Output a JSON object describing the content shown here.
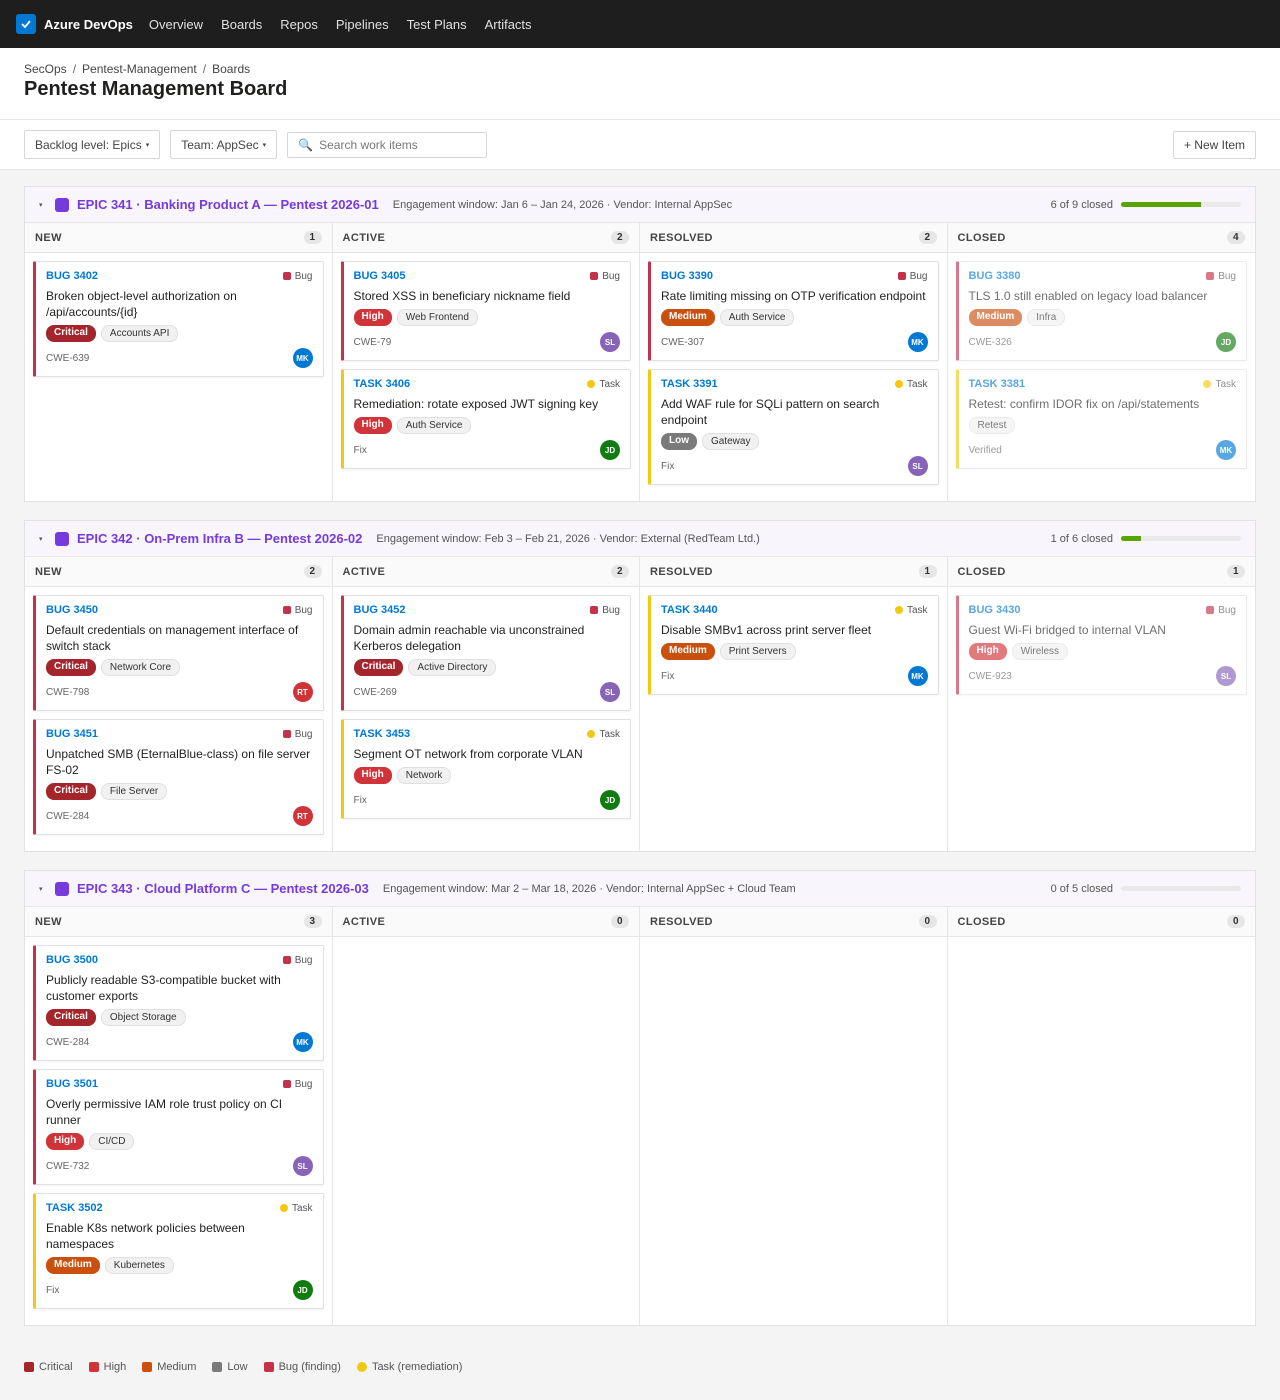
{
  "app": {
    "title": "Azure DevOps"
  },
  "nav": [
    "Overview",
    "Boards",
    "Repos",
    "Pipelines",
    "Test Plans",
    "Artifacts"
  ],
  "breadcrumb": [
    "SecOps",
    "Pentest-Management",
    "Boards"
  ],
  "page_title": "Pentest Management Board",
  "toolbar": {
    "backlog": "Backlog level: Epics",
    "team": "Team: AppSec",
    "search_placeholder": "Search work items",
    "new_item": "+ New Item"
  },
  "severity_colors": {
    "Critical": "#a4262c",
    "High": "#d13438",
    "Medium": "#ca5010",
    "Low": "#7a7a7a"
  },
  "epics": [
    {
      "title": "EPIC 341 · Banking Product A — Pentest 2026-01",
      "meta": "Engagement window: Jan 6 – Jan 24, 2026 · Vendor: Internal AppSec",
      "progress_text": "6 of 9 closed",
      "progress": 0.667,
      "columns": [
        {
          "name": "NEW",
          "count": "1",
          "cards": [
            {
              "id": "BUG 3402",
              "type": "Bug",
              "title": "Broken object-level authorization on /api/accounts/{id}",
              "severity": "Critical",
              "area": "Accounts API",
              "ref": "CWE-639",
              "assignee": "MK",
              "avatar_color": "#0078d4"
            }
          ]
        },
        {
          "name": "ACTIVE",
          "count": "2",
          "cards": [
            {
              "id": "BUG 3405",
              "type": "Bug",
              "title": "Stored XSS in beneficiary nickname field",
              "severity": "High",
              "area": "Web Frontend",
              "ref": "CWE-79",
              "assignee": "SL",
              "avatar_color": "#8764b8"
            },
            {
              "id": "TASK 3406",
              "type": "Task",
              "title": "Remediation: rotate exposed JWT signing key",
              "severity": "High",
              "area": "Auth Service",
              "ref": "Fix",
              "assignee": "JD",
              "avatar_color": "#107c10"
            }
          ]
        },
        {
          "name": "RESOLVED",
          "count": "2",
          "cards": [
            {
              "id": "BUG 3390",
              "type": "Bug",
              "title": "Rate limiting missing on OTP verification endpoint",
              "severity": "Medium",
              "area": "Auth Service",
              "ref": "CWE-307",
              "assignee": "MK",
              "avatar_color": "#0078d4"
            },
            {
              "id": "TASK 3391",
              "type": "Task",
              "title": "Add WAF rule for SQLi pattern on search endpoint",
              "severity": "Low",
              "area": "Gateway",
              "ref": "Fix",
              "assignee": "SL",
              "avatar_color": "#8764b8"
            }
          ]
        },
        {
          "name": "CLOSED",
          "count": "4",
          "closed": true,
          "cards": [
            {
              "id": "BUG 3380",
              "type": "Bug",
              "title": "TLS 1.0 still enabled on legacy load balancer",
              "severity": "Medium",
              "area": "Infra",
              "ref": "CWE-326",
              "assignee": "JD",
              "avatar_color": "#107c10"
            },
            {
              "id": "TASK 3381",
              "type": "Task",
              "title": "Retest: confirm IDOR fix on /api/statements",
              "severity": "",
              "area": "Retest",
              "ref": "Verified",
              "assignee": "MK",
              "avatar_color": "#0078d4"
            }
          ]
        }
      ]
    },
    {
      "title": "EPIC 342 · On-Prem Infra B — Pentest 2026-02",
      "meta": "Engagement window: Feb 3 – Feb 21, 2026 · Vendor: External (RedTeam Ltd.)",
      "progress_text": "1 of 6 closed",
      "progress": 0.167,
      "columns": [
        {
          "name": "NEW",
          "count": "2",
          "cards": [
            {
              "id": "BUG 3450",
              "type": "Bug",
              "title": "Default credentials on management interface of switch stack",
              "severity": "Critical",
              "area": "Network Core",
              "ref": "CWE-798",
              "assignee": "RT",
              "avatar_color": "#d13438"
            },
            {
              "id": "BUG 3451",
              "type": "Bug",
              "title": "Unpatched SMB (EternalBlue-class) on file server FS-02",
              "severity": "Critical",
              "area": "File Server",
              "ref": "CWE-284",
              "assignee": "RT",
              "avatar_color": "#d13438"
            }
          ]
        },
        {
          "name": "ACTIVE",
          "count": "2",
          "cards": [
            {
              "id": "BUG 3452",
              "type": "Bug",
              "title": "Domain admin reachable via unconstrained Kerberos delegation",
              "severity": "Critical",
              "area": "Active Directory",
              "ref": "CWE-269",
              "assignee": "SL",
              "avatar_color": "#8764b8"
            },
            {
              "id": "TASK 3453",
              "type": "Task",
              "title": "Segment OT network from corporate VLAN",
              "severity": "High",
              "area": "Network",
              "ref": "Fix",
              "assignee": "JD",
              "avatar_color": "#107c10"
            }
          ]
        },
        {
          "name": "RESOLVED",
          "count": "1",
          "cards": [
            {
              "id": "TASK 3440",
              "type": "Task",
              "title": "Disable SMBv1 across print server fleet",
              "severity": "Medium",
              "area": "Print Servers",
              "ref": "Fix",
              "assignee": "MK",
              "avatar_color": "#0078d4"
            }
          ]
        },
        {
          "name": "CLOSED",
          "count": "1",
          "closed": true,
          "cards": [
            {
              "id": "BUG 3430",
              "type": "Bug",
              "title": "Guest Wi-Fi bridged to internal VLAN",
              "severity": "High",
              "area": "Wireless",
              "ref": "CWE-923",
              "assignee": "SL",
              "avatar_color": "#8764b8"
            }
          ]
        }
      ]
    },
    {
      "title": "EPIC 343 · Cloud Platform C — Pentest 2026-03",
      "meta": "Engagement window: Mar 2 – Mar 18, 2026 · Vendor: Internal AppSec + Cloud Team",
      "progress_text": "0 of 5 closed",
      "progress": 0,
      "columns": [
        {
          "name": "NEW",
          "count": "3",
          "cards": [
            {
              "id": "BUG 3500",
              "type": "Bug",
              "title": "Publicly readable S3-compatible bucket with customer exports",
              "severity": "Critical",
              "area": "Object Storage",
              "ref": "CWE-284",
              "assignee": "MK",
              "avatar_color": "#0078d4"
            },
            {
              "id": "BUG 3501",
              "type": "Bug",
              "title": "Overly permissive IAM role trust policy on CI runner",
              "severity": "High",
              "area": "CI/CD",
              "ref": "CWE-732",
              "assignee": "SL",
              "avatar_color": "#8764b8"
            },
            {
              "id": "TASK 3502",
              "type": "Task",
              "title": "Enable K8s network policies between namespaces",
              "severity": "Medium",
              "area": "Kubernetes",
              "ref": "Fix",
              "assignee": "JD",
              "avatar_color": "#107c10"
            }
          ]
        },
        {
          "name": "ACTIVE",
          "count": "0",
          "cards": []
        },
        {
          "name": "RESOLVED",
          "count": "0",
          "cards": []
        },
        {
          "name": "CLOSED",
          "count": "0",
          "cards": []
        }
      ]
    }
  ],
  "legend": [
    {
      "label": "Critical",
      "color": "#a4262c",
      "shape": "square"
    },
    {
      "label": "High",
      "color": "#d13438",
      "shape": "square"
    },
    {
      "label": "Medium",
      "color": "#ca5010",
      "shape": "square"
    },
    {
      "label": "Low",
      "color": "#7a7a7a",
      "shape": "square"
    },
    {
      "label": "Bug (finding)",
      "color": "#c4314b",
      "shape": "square"
    },
    {
      "label": "Task (remediation)",
      "color": "#f2c811",
      "shape": "circle"
    }
  ]
}
